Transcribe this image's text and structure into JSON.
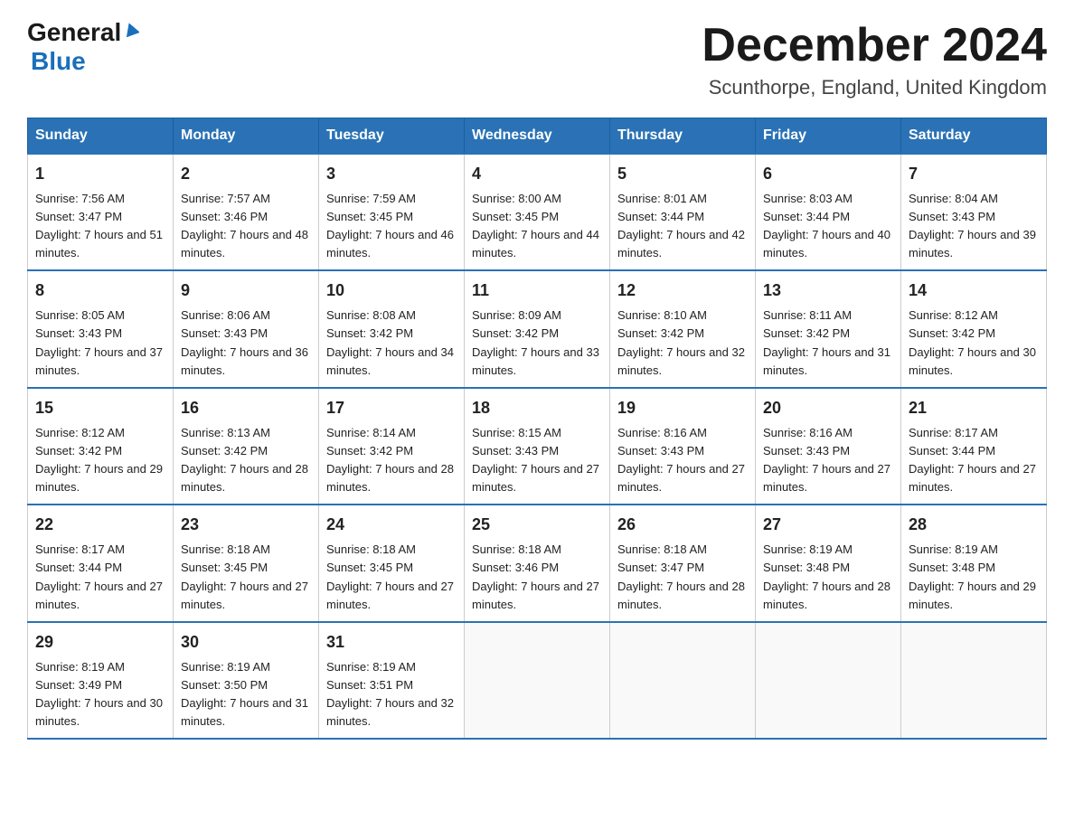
{
  "header": {
    "logo_general": "General",
    "logo_blue": "Blue",
    "month_title": "December 2024",
    "location": "Scunthorpe, England, United Kingdom"
  },
  "days_of_week": [
    "Sunday",
    "Monday",
    "Tuesday",
    "Wednesday",
    "Thursday",
    "Friday",
    "Saturday"
  ],
  "weeks": [
    [
      {
        "day": "1",
        "sunrise": "Sunrise: 7:56 AM",
        "sunset": "Sunset: 3:47 PM",
        "daylight": "Daylight: 7 hours and 51 minutes."
      },
      {
        "day": "2",
        "sunrise": "Sunrise: 7:57 AM",
        "sunset": "Sunset: 3:46 PM",
        "daylight": "Daylight: 7 hours and 48 minutes."
      },
      {
        "day": "3",
        "sunrise": "Sunrise: 7:59 AM",
        "sunset": "Sunset: 3:45 PM",
        "daylight": "Daylight: 7 hours and 46 minutes."
      },
      {
        "day": "4",
        "sunrise": "Sunrise: 8:00 AM",
        "sunset": "Sunset: 3:45 PM",
        "daylight": "Daylight: 7 hours and 44 minutes."
      },
      {
        "day": "5",
        "sunrise": "Sunrise: 8:01 AM",
        "sunset": "Sunset: 3:44 PM",
        "daylight": "Daylight: 7 hours and 42 minutes."
      },
      {
        "day": "6",
        "sunrise": "Sunrise: 8:03 AM",
        "sunset": "Sunset: 3:44 PM",
        "daylight": "Daylight: 7 hours and 40 minutes."
      },
      {
        "day": "7",
        "sunrise": "Sunrise: 8:04 AM",
        "sunset": "Sunset: 3:43 PM",
        "daylight": "Daylight: 7 hours and 39 minutes."
      }
    ],
    [
      {
        "day": "8",
        "sunrise": "Sunrise: 8:05 AM",
        "sunset": "Sunset: 3:43 PM",
        "daylight": "Daylight: 7 hours and 37 minutes."
      },
      {
        "day": "9",
        "sunrise": "Sunrise: 8:06 AM",
        "sunset": "Sunset: 3:43 PM",
        "daylight": "Daylight: 7 hours and 36 minutes."
      },
      {
        "day": "10",
        "sunrise": "Sunrise: 8:08 AM",
        "sunset": "Sunset: 3:42 PM",
        "daylight": "Daylight: 7 hours and 34 minutes."
      },
      {
        "day": "11",
        "sunrise": "Sunrise: 8:09 AM",
        "sunset": "Sunset: 3:42 PM",
        "daylight": "Daylight: 7 hours and 33 minutes."
      },
      {
        "day": "12",
        "sunrise": "Sunrise: 8:10 AM",
        "sunset": "Sunset: 3:42 PM",
        "daylight": "Daylight: 7 hours and 32 minutes."
      },
      {
        "day": "13",
        "sunrise": "Sunrise: 8:11 AM",
        "sunset": "Sunset: 3:42 PM",
        "daylight": "Daylight: 7 hours and 31 minutes."
      },
      {
        "day": "14",
        "sunrise": "Sunrise: 8:12 AM",
        "sunset": "Sunset: 3:42 PM",
        "daylight": "Daylight: 7 hours and 30 minutes."
      }
    ],
    [
      {
        "day": "15",
        "sunrise": "Sunrise: 8:12 AM",
        "sunset": "Sunset: 3:42 PM",
        "daylight": "Daylight: 7 hours and 29 minutes."
      },
      {
        "day": "16",
        "sunrise": "Sunrise: 8:13 AM",
        "sunset": "Sunset: 3:42 PM",
        "daylight": "Daylight: 7 hours and 28 minutes."
      },
      {
        "day": "17",
        "sunrise": "Sunrise: 8:14 AM",
        "sunset": "Sunset: 3:42 PM",
        "daylight": "Daylight: 7 hours and 28 minutes."
      },
      {
        "day": "18",
        "sunrise": "Sunrise: 8:15 AM",
        "sunset": "Sunset: 3:43 PM",
        "daylight": "Daylight: 7 hours and 27 minutes."
      },
      {
        "day": "19",
        "sunrise": "Sunrise: 8:16 AM",
        "sunset": "Sunset: 3:43 PM",
        "daylight": "Daylight: 7 hours and 27 minutes."
      },
      {
        "day": "20",
        "sunrise": "Sunrise: 8:16 AM",
        "sunset": "Sunset: 3:43 PM",
        "daylight": "Daylight: 7 hours and 27 minutes."
      },
      {
        "day": "21",
        "sunrise": "Sunrise: 8:17 AM",
        "sunset": "Sunset: 3:44 PM",
        "daylight": "Daylight: 7 hours and 27 minutes."
      }
    ],
    [
      {
        "day": "22",
        "sunrise": "Sunrise: 8:17 AM",
        "sunset": "Sunset: 3:44 PM",
        "daylight": "Daylight: 7 hours and 27 minutes."
      },
      {
        "day": "23",
        "sunrise": "Sunrise: 8:18 AM",
        "sunset": "Sunset: 3:45 PM",
        "daylight": "Daylight: 7 hours and 27 minutes."
      },
      {
        "day": "24",
        "sunrise": "Sunrise: 8:18 AM",
        "sunset": "Sunset: 3:45 PM",
        "daylight": "Daylight: 7 hours and 27 minutes."
      },
      {
        "day": "25",
        "sunrise": "Sunrise: 8:18 AM",
        "sunset": "Sunset: 3:46 PM",
        "daylight": "Daylight: 7 hours and 27 minutes."
      },
      {
        "day": "26",
        "sunrise": "Sunrise: 8:18 AM",
        "sunset": "Sunset: 3:47 PM",
        "daylight": "Daylight: 7 hours and 28 minutes."
      },
      {
        "day": "27",
        "sunrise": "Sunrise: 8:19 AM",
        "sunset": "Sunset: 3:48 PM",
        "daylight": "Daylight: 7 hours and 28 minutes."
      },
      {
        "day": "28",
        "sunrise": "Sunrise: 8:19 AM",
        "sunset": "Sunset: 3:48 PM",
        "daylight": "Daylight: 7 hours and 29 minutes."
      }
    ],
    [
      {
        "day": "29",
        "sunrise": "Sunrise: 8:19 AM",
        "sunset": "Sunset: 3:49 PM",
        "daylight": "Daylight: 7 hours and 30 minutes."
      },
      {
        "day": "30",
        "sunrise": "Sunrise: 8:19 AM",
        "sunset": "Sunset: 3:50 PM",
        "daylight": "Daylight: 7 hours and 31 minutes."
      },
      {
        "day": "31",
        "sunrise": "Sunrise: 8:19 AM",
        "sunset": "Sunset: 3:51 PM",
        "daylight": "Daylight: 7 hours and 32 minutes."
      },
      null,
      null,
      null,
      null
    ]
  ]
}
